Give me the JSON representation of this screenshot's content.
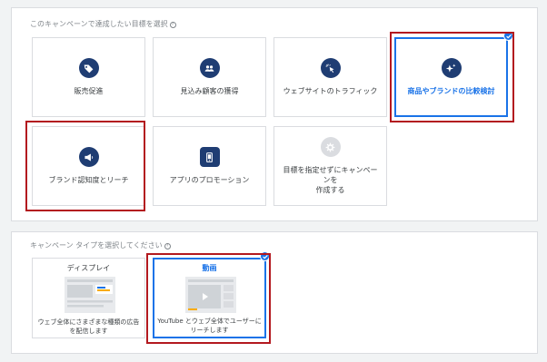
{
  "goals_section": {
    "title": "このキャンペーンで達成したい目標を選択",
    "help_icon": "help-icon",
    "cards": [
      {
        "id": "sales",
        "label": "販売促進",
        "icon": "tag-icon",
        "selected": false
      },
      {
        "id": "leads",
        "label": "見込み顧客の獲得",
        "icon": "people-icon",
        "selected": false
      },
      {
        "id": "traffic",
        "label": "ウェブサイトのトラフィック",
        "icon": "click-icon",
        "selected": false
      },
      {
        "id": "consideration",
        "label": "商品やブランドの比較検討",
        "icon": "sparkle-icon",
        "selected": true
      },
      {
        "id": "awareness",
        "label": "ブランド認知度とリーチ",
        "icon": "megaphone-icon",
        "selected": false
      },
      {
        "id": "app",
        "label": "アプリのプロモーション",
        "icon": "phone-icon",
        "selected": false
      },
      {
        "id": "no_goal",
        "label": "目標を指定せずにキャンペーンを作成する",
        "label_line1": "目標を指定せずにキャンペーンを",
        "label_line2": "作成する",
        "icon": "gear-icon",
        "selected": false
      }
    ]
  },
  "type_section": {
    "title": "キャンペーン タイプを選択してください",
    "help_icon": "help-icon",
    "cards": [
      {
        "id": "display",
        "title": "ディスプレイ",
        "desc_line1": "ウェブ全体にさまざまな種類の広告",
        "desc_line2": "を配信します",
        "selected": false
      },
      {
        "id": "video",
        "title": "動画",
        "desc_line1": "YouTube とウェブ全体でユーザーに",
        "desc_line2": "リーチします",
        "selected": true
      }
    ]
  },
  "colors": {
    "selected_border": "#1a73e8",
    "icon_bg": "#1f3d73",
    "highlight_frame": "#b3191f",
    "accent_yellow": "#f9ab00"
  }
}
